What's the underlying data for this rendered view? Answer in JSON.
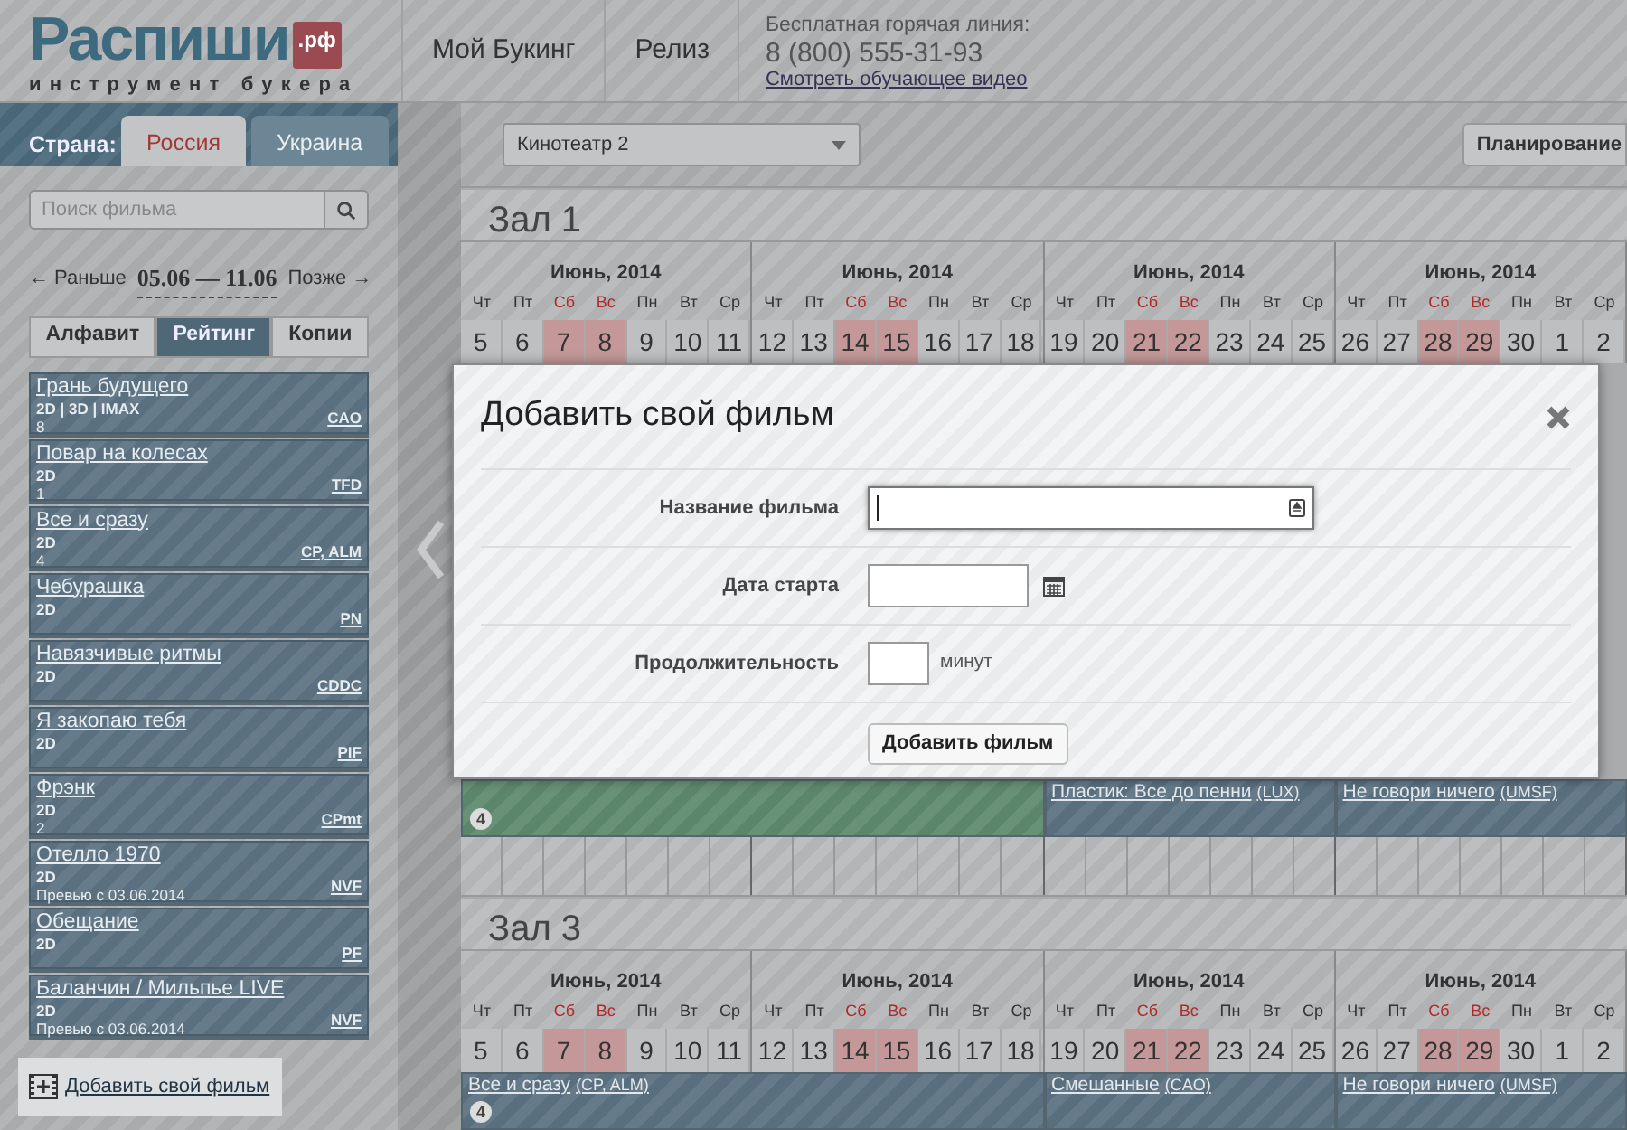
{
  "header": {
    "logo": {
      "name": "Распиши",
      "domain": ".рф",
      "tagline": "инструмент букера"
    },
    "nav": [
      {
        "label": "Мой Букинг"
      },
      {
        "label": "Релиз"
      }
    ],
    "hotline": {
      "label": "Бесплатная горячая линия:",
      "phone": "8 (800) 555-31-93",
      "link": "Смотреть обучающее видео"
    }
  },
  "sidebar": {
    "country_label": "Страна:",
    "countries": [
      {
        "label": "Россия",
        "selected": true
      },
      {
        "label": "Украина",
        "selected": false
      }
    ],
    "search": {
      "placeholder": "Поиск фильма"
    },
    "period": {
      "prev": "← Раньше",
      "range": "05.06 — 11.06",
      "next": "Позже →"
    },
    "sort_tabs": [
      {
        "label": "Алфавит",
        "selected": false
      },
      {
        "label": "Рейтинг",
        "selected": true
      },
      {
        "label": "Копии",
        "selected": false
      }
    ],
    "films": [
      {
        "title": "Грань будущего",
        "format": "2D | 3D | IMAX",
        "note": "8",
        "distributors": "CAO"
      },
      {
        "title": "Повар на колесах",
        "format": "2D",
        "note": "1",
        "distributors": "TFD"
      },
      {
        "title": "Все и сразу",
        "format": "2D",
        "note": "4",
        "distributors": "CP, ALM"
      },
      {
        "title": "Чебурашка",
        "format": "2D",
        "distributors": "PN"
      },
      {
        "title": "Навязчивые ритмы",
        "format": "2D",
        "distributors": "CDDC"
      },
      {
        "title": "Я закопаю тебя",
        "format": "2D",
        "distributors": "PIF"
      },
      {
        "title": "Фрэнк",
        "format": "2D",
        "note": "2",
        "distributors": "CPmt"
      },
      {
        "title": "Отелло 1970",
        "format": "2D",
        "note": "Превью с 03.06.2014",
        "distributors": "NVF"
      },
      {
        "title": "Обещание",
        "format": "2D",
        "distributors": "PF"
      },
      {
        "title": "Баланчин / Мильпье LIVE",
        "format": "2D",
        "note": "Превью с 03.06.2014",
        "distributors": "NVF"
      }
    ],
    "add_button": "Добавить свой фильм"
  },
  "main": {
    "cinema_select": "Кинотеатр 2",
    "planning_button": "Планирование",
    "sections": [
      {
        "kind": "hall",
        "title": "Зал 1",
        "weeks": [
          {
            "month": "Июнь, 2014",
            "days": [
              {
                "dow": "Чт",
                "date": "5",
                "weekend": false
              },
              {
                "dow": "Пт",
                "date": "6",
                "weekend": false
              },
              {
                "dow": "Сб",
                "date": "7",
                "weekend": true
              },
              {
                "dow": "Вс",
                "date": "8",
                "weekend": true
              },
              {
                "dow": "Пн",
                "date": "9",
                "weekend": false
              },
              {
                "dow": "Вт",
                "date": "10",
                "weekend": false
              },
              {
                "dow": "Ср",
                "date": "11",
                "weekend": false
              }
            ]
          },
          {
            "month": "Июнь, 2014",
            "days": [
              {
                "dow": "Чт",
                "date": "12",
                "weekend": false
              },
              {
                "dow": "Пт",
                "date": "13",
                "weekend": false
              },
              {
                "dow": "Сб",
                "date": "14",
                "weekend": true
              },
              {
                "dow": "Вс",
                "date": "15",
                "weekend": true
              },
              {
                "dow": "Пн",
                "date": "16",
                "weekend": false
              },
              {
                "dow": "Вт",
                "date": "17",
                "weekend": false
              },
              {
                "dow": "Ср",
                "date": "18",
                "weekend": false
              }
            ]
          },
          {
            "month": "Июнь, 2014",
            "days": [
              {
                "dow": "Чт",
                "date": "19",
                "weekend": false
              },
              {
                "dow": "Пт",
                "date": "20",
                "weekend": false
              },
              {
                "dow": "Сб",
                "date": "21",
                "weekend": true
              },
              {
                "dow": "Вс",
                "date": "22",
                "weekend": true
              },
              {
                "dow": "Пн",
                "date": "23",
                "weekend": false
              },
              {
                "dow": "Вт",
                "date": "24",
                "weekend": false
              },
              {
                "dow": "Ср",
                "date": "25",
                "weekend": false
              }
            ]
          },
          {
            "month": "Июнь, 2014",
            "days": [
              {
                "dow": "Чт",
                "date": "26",
                "weekend": false
              },
              {
                "dow": "Пт",
                "date": "27",
                "weekend": false
              },
              {
                "dow": "Сб",
                "date": "28",
                "weekend": true
              },
              {
                "dow": "Вс",
                "date": "29",
                "weekend": true
              },
              {
                "dow": "Пн",
                "date": "30",
                "weekend": false
              },
              {
                "dow": "Вт",
                "date": "1",
                "weekend": false
              },
              {
                "dow": "Ср",
                "date": "2",
                "weekend": false
              }
            ]
          }
        ]
      },
      {
        "kind": "modal",
        "title": "Добавить свой фильм",
        "fields": [
          {
            "kind": "text",
            "label": "Название фильма"
          },
          {
            "kind": "date",
            "label": "Дата старта"
          },
          {
            "kind": "duration",
            "label": "Продолжительность",
            "unit": "минут"
          }
        ],
        "submit": "Добавить фильм"
      },
      {
        "kind": "bookings",
        "entries": [
          {
            "kind": "double",
            "color": "#5f8a6e",
            "badge": "4"
          },
          {
            "kind": "single",
            "color": "#5c7282",
            "title": "Пластик: Все до пенни",
            "distributors": "(LUX)"
          },
          {
            "kind": "single",
            "color": "#5c7282",
            "title": "Не говори ничего",
            "distributors": "(UMSF)"
          }
        ]
      },
      {
        "kind": "grid_row"
      },
      {
        "kind": "hall",
        "title": "Зал 3",
        "weeks": [
          {
            "month": "Июнь, 2014",
            "days": [
              {
                "dow": "Чт",
                "date": "5",
                "weekend": false
              },
              {
                "dow": "Пт",
                "date": "6",
                "weekend": false
              },
              {
                "dow": "Сб",
                "date": "7",
                "weekend": true
              },
              {
                "dow": "Вс",
                "date": "8",
                "weekend": true
              },
              {
                "dow": "Пн",
                "date": "9",
                "weekend": false
              },
              {
                "dow": "Вт",
                "date": "10",
                "weekend": false
              },
              {
                "dow": "Ср",
                "date": "11",
                "weekend": false
              }
            ]
          },
          {
            "month": "Июнь, 2014",
            "days": [
              {
                "dow": "Чт",
                "date": "12",
                "weekend": false
              },
              {
                "dow": "Пт",
                "date": "13",
                "weekend": false
              },
              {
                "dow": "Сб",
                "date": "14",
                "weekend": true
              },
              {
                "dow": "Вс",
                "date": "15",
                "weekend": true
              },
              {
                "dow": "Пн",
                "date": "16",
                "weekend": false
              },
              {
                "dow": "Вт",
                "date": "17",
                "weekend": false
              },
              {
                "dow": "Ср",
                "date": "18",
                "weekend": false
              }
            ]
          },
          {
            "month": "Июнь, 2014",
            "days": [
              {
                "dow": "Чт",
                "date": "19",
                "weekend": false
              },
              {
                "dow": "Пт",
                "date": "20",
                "weekend": false
              },
              {
                "dow": "Сб",
                "date": "21",
                "weekend": true
              },
              {
                "dow": "Вс",
                "date": "22",
                "weekend": true
              },
              {
                "dow": "Пн",
                "date": "23",
                "weekend": false
              },
              {
                "dow": "Вт",
                "date": "24",
                "weekend": false
              },
              {
                "dow": "Ср",
                "date": "25",
                "weekend": false
              }
            ]
          },
          {
            "month": "Июнь, 2014",
            "days": [
              {
                "dow": "Чт",
                "date": "26",
                "weekend": false
              },
              {
                "dow": "Пт",
                "date": "27",
                "weekend": false
              },
              {
                "dow": "Сб",
                "date": "28",
                "weekend": true
              },
              {
                "dow": "Вс",
                "date": "29",
                "weekend": true
              },
              {
                "dow": "Пн",
                "date": "30",
                "weekend": false
              },
              {
                "dow": "Вт",
                "date": "1",
                "weekend": false
              },
              {
                "dow": "Ср",
                "date": "2",
                "weekend": false
              }
            ]
          }
        ]
      },
      {
        "kind": "bookings",
        "entries": [
          {
            "kind": "double",
            "color": "#5c7282",
            "title": "Все и сразу",
            "distributors": "(CP, ALM)",
            "badge": "4"
          },
          {
            "kind": "single",
            "color": "#5c7282",
            "title": "Смешанные",
            "distributors": "(CAO)"
          },
          {
            "kind": "single",
            "color": "#5c7282",
            "title": "Не говори ничего",
            "distributors": "(UMSF)"
          }
        ]
      }
    ]
  }
}
